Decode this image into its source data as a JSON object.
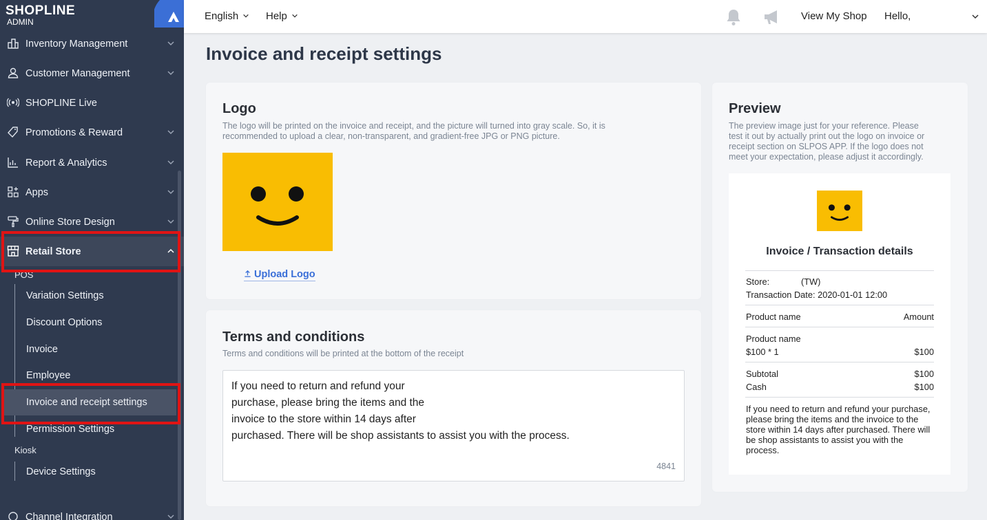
{
  "brand": {
    "name": "SHOPLINE",
    "sub": "ADMIN"
  },
  "sidebar": {
    "items": [
      {
        "label": "Inventory Management",
        "icon": "inventory-icon"
      },
      {
        "label": "Customer Management",
        "icon": "user-icon"
      },
      {
        "label": "SHOPLINE Live",
        "icon": "live-icon"
      },
      {
        "label": "Promotions & Reward",
        "icon": "tag-icon"
      },
      {
        "label": "Report & Analytics",
        "icon": "chart-icon"
      },
      {
        "label": "Apps",
        "icon": "apps-icon"
      },
      {
        "label": "Online Store Design",
        "icon": "paint-roller-icon"
      },
      {
        "label": "Retail Store",
        "icon": "store-icon"
      }
    ],
    "pos_label": "POS",
    "pos_items": [
      "Variation Settings",
      "Discount Options",
      "Invoice",
      "Employee",
      "Invoice and receipt settings",
      "Permission Settings"
    ],
    "kiosk_label": "Kiosk",
    "kiosk_items": [
      "Device Settings"
    ],
    "bottom_item": "Channel Integration"
  },
  "topbar": {
    "language": "English",
    "help": "Help",
    "view_shop": "View My Shop",
    "hello": "Hello,"
  },
  "page": {
    "title": "Invoice and receipt settings"
  },
  "logo_card": {
    "title": "Logo",
    "desc_line1": "The logo will be printed on the invoice and receipt, and the picture will turned into gray scale. So, it is",
    "desc_line2": "recommended to upload a clear, non-transparent, and gradient-free JPG or PNG picture.",
    "upload": "Upload Logo"
  },
  "terms_card": {
    "title": "Terms and conditions",
    "desc": "Terms and conditions will be printed at the bottom of the receipt",
    "lines": [
      "If you need to return and refund your",
      "purchase, please bring the items and the",
      "invoice to the store within 14 days after",
      "purchased. There will be shop assistants to assist you with the process."
    ],
    "counter": "4841"
  },
  "preview": {
    "title": "Preview",
    "desc_lines": [
      "The preview image just for your reference. Please",
      "test it out by actually print out the logo on invoice or",
      "receipt section on SLPOS APP. If the logo does not",
      "meet your expectation, please adjust it accordingly."
    ],
    "receipt_title": "Invoice / Transaction details",
    "store_label": "Store:",
    "store_value": "(TW)",
    "transaction_date": "Transaction Date: 2020-01-01 12:00",
    "col_product": "Product name",
    "col_amount": "Amount",
    "item_name": "Product name",
    "item_qty": "$100 * 1",
    "item_amount": "$100",
    "subtotal_label": "Subtotal",
    "subtotal_value": "$100",
    "cash_label": "Cash",
    "cash_value": "$100",
    "terms": "If you need to return and refund your purchase, please bring the items and the invoice to the store within 14 days after purchased. There will be shop assistants to assist you with the process."
  }
}
